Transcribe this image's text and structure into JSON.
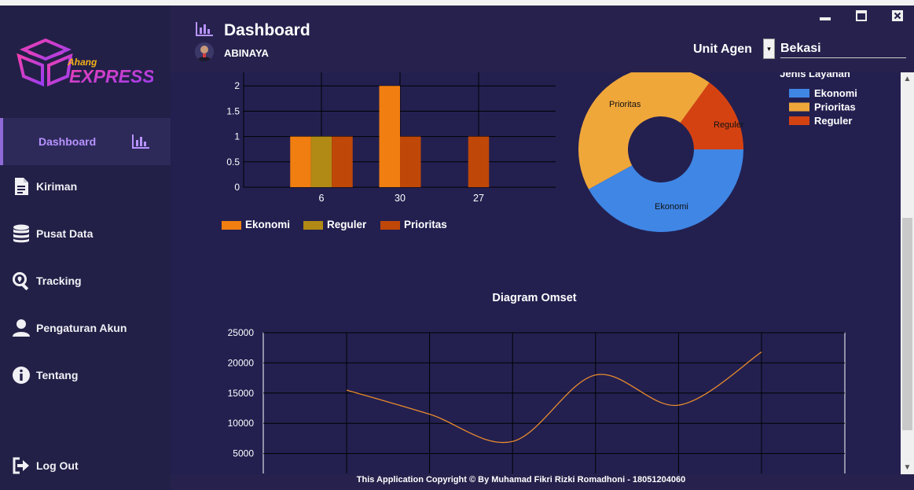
{
  "app": {
    "brand_small": "Ahang",
    "brand_large": "EXPRESS",
    "brand_colors": {
      "magenta": "#d437e8",
      "purple": "#9a3df0",
      "gold": "#f5b21a"
    }
  },
  "sidebar": {
    "items": [
      {
        "label": "Dashboard",
        "icon": "bar-chart-icon",
        "active": true
      },
      {
        "label": "Kiriman",
        "icon": "document-icon"
      },
      {
        "label": "Pusat Data",
        "icon": "database-icon"
      },
      {
        "label": "Tracking",
        "icon": "search-location-icon"
      },
      {
        "label": "Pengaturan Akun",
        "icon": "user-icon"
      },
      {
        "label": "Tentang",
        "icon": "info-icon"
      }
    ],
    "logout_label": "Log Out"
  },
  "header": {
    "title": "Dashboard",
    "user_name": "ABINAYA",
    "unit_label": "Unit Agen",
    "unit_value": "Bekasi"
  },
  "colors": {
    "ekonomi_bar": "#f17e10",
    "reguler_bar": "#b08a14",
    "prioritas_bar": "#bf4708",
    "pie_ekonomi": "#3f86e5",
    "pie_prioritas": "#f0a73a",
    "pie_reguler": "#d54212",
    "omset_line": "#e88a2c"
  },
  "chart_data": [
    {
      "type": "bar",
      "categories": [
        "6",
        "30",
        "27"
      ],
      "series": [
        {
          "name": "Ekonomi",
          "values": [
            1,
            2,
            0
          ]
        },
        {
          "name": "Reguler",
          "values": [
            1,
            0,
            0
          ]
        },
        {
          "name": "Prioritas",
          "values": [
            1,
            1,
            1
          ]
        }
      ],
      "yticks": [
        "0",
        "0.5",
        "1",
        "1.5",
        "2"
      ],
      "ylim": [
        0,
        2.5
      ],
      "legend": "bottom"
    },
    {
      "type": "pie",
      "title": "Jenis Layanan",
      "labels": [
        "Ekonomi",
        "Prioritas",
        "Reguler"
      ],
      "values": [
        42,
        43,
        15
      ],
      "legend": "right"
    },
    {
      "type": "line",
      "title": "Diagram Omset",
      "x": [
        1,
        2,
        3,
        4,
        5,
        6
      ],
      "values": [
        15500,
        11500,
        7000,
        18000,
        13000,
        21800
      ],
      "yticks": [
        "5000",
        "10000",
        "15000",
        "20000",
        "25000"
      ],
      "ylim": [
        0,
        25000
      ]
    }
  ],
  "footer": {
    "copyright": "This Application Copyright © By Muhamad Fikri Rizki Romadhoni - 18051204060"
  }
}
